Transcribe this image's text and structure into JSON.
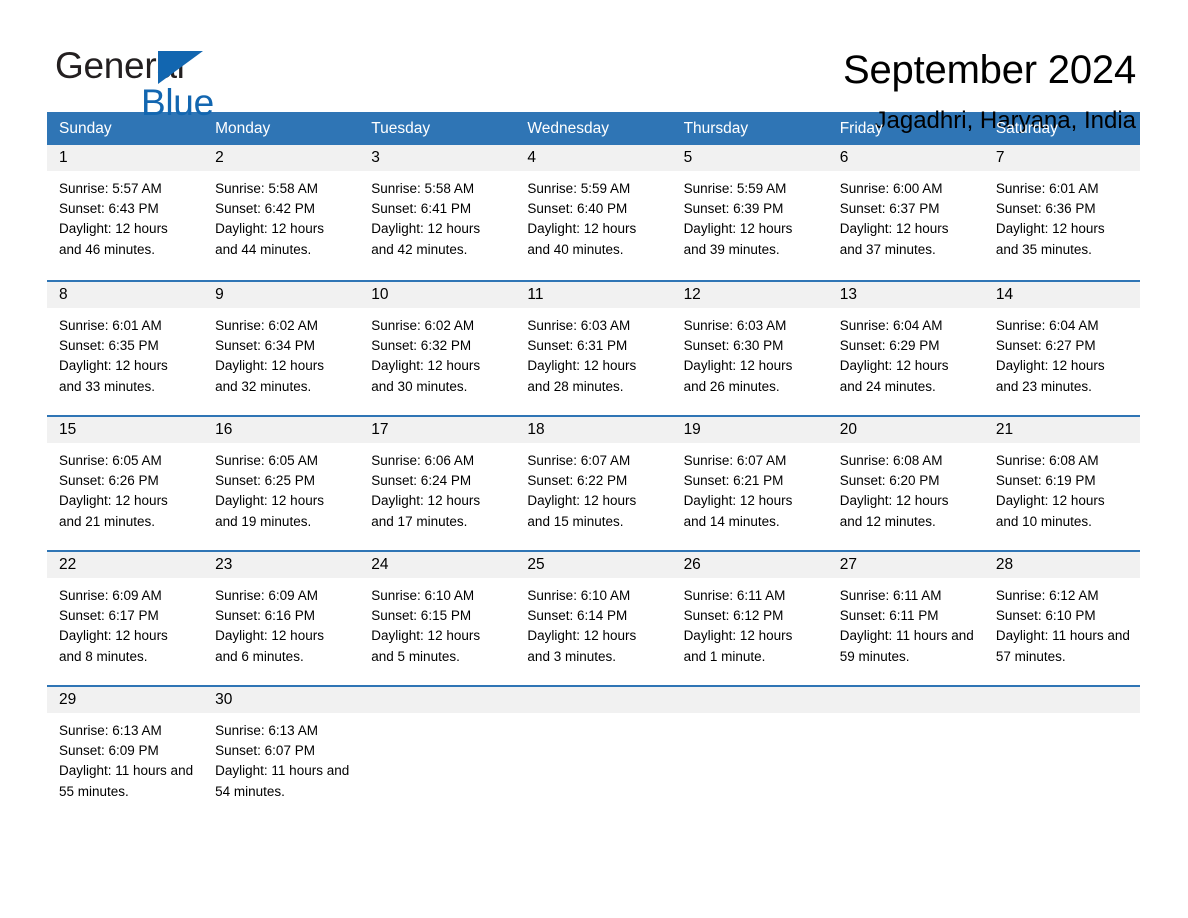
{
  "brand": {
    "name_dark": "General",
    "name_blue": "Blue",
    "accent_color": "#1266b0"
  },
  "header": {
    "month_title": "September 2024",
    "location": "Jagadhri, Haryana, India"
  },
  "theme": {
    "header_blue": "#2f75b5",
    "day_band_gray": "#f1f1f1",
    "text_color": "#000000"
  },
  "calendar": {
    "weekdays": [
      "Sunday",
      "Monday",
      "Tuesday",
      "Wednesday",
      "Thursday",
      "Friday",
      "Saturday"
    ],
    "weeks": [
      [
        {
          "day": "1",
          "sunrise": "Sunrise: 5:57 AM",
          "sunset": "Sunset: 6:43 PM",
          "daylight": "Daylight: 12 hours and 46 minutes."
        },
        {
          "day": "2",
          "sunrise": "Sunrise: 5:58 AM",
          "sunset": "Sunset: 6:42 PM",
          "daylight": "Daylight: 12 hours and 44 minutes."
        },
        {
          "day": "3",
          "sunrise": "Sunrise: 5:58 AM",
          "sunset": "Sunset: 6:41 PM",
          "daylight": "Daylight: 12 hours and 42 minutes."
        },
        {
          "day": "4",
          "sunrise": "Sunrise: 5:59 AM",
          "sunset": "Sunset: 6:40 PM",
          "daylight": "Daylight: 12 hours and 40 minutes."
        },
        {
          "day": "5",
          "sunrise": "Sunrise: 5:59 AM",
          "sunset": "Sunset: 6:39 PM",
          "daylight": "Daylight: 12 hours and 39 minutes."
        },
        {
          "day": "6",
          "sunrise": "Sunrise: 6:00 AM",
          "sunset": "Sunset: 6:37 PM",
          "daylight": "Daylight: 12 hours and 37 minutes."
        },
        {
          "day": "7",
          "sunrise": "Sunrise: 6:01 AM",
          "sunset": "Sunset: 6:36 PM",
          "daylight": "Daylight: 12 hours and 35 minutes."
        }
      ],
      [
        {
          "day": "8",
          "sunrise": "Sunrise: 6:01 AM",
          "sunset": "Sunset: 6:35 PM",
          "daylight": "Daylight: 12 hours and 33 minutes."
        },
        {
          "day": "9",
          "sunrise": "Sunrise: 6:02 AM",
          "sunset": "Sunset: 6:34 PM",
          "daylight": "Daylight: 12 hours and 32 minutes."
        },
        {
          "day": "10",
          "sunrise": "Sunrise: 6:02 AM",
          "sunset": "Sunset: 6:32 PM",
          "daylight": "Daylight: 12 hours and 30 minutes."
        },
        {
          "day": "11",
          "sunrise": "Sunrise: 6:03 AM",
          "sunset": "Sunset: 6:31 PM",
          "daylight": "Daylight: 12 hours and 28 minutes."
        },
        {
          "day": "12",
          "sunrise": "Sunrise: 6:03 AM",
          "sunset": "Sunset: 6:30 PM",
          "daylight": "Daylight: 12 hours and 26 minutes."
        },
        {
          "day": "13",
          "sunrise": "Sunrise: 6:04 AM",
          "sunset": "Sunset: 6:29 PM",
          "daylight": "Daylight: 12 hours and 24 minutes."
        },
        {
          "day": "14",
          "sunrise": "Sunrise: 6:04 AM",
          "sunset": "Sunset: 6:27 PM",
          "daylight": "Daylight: 12 hours and 23 minutes."
        }
      ],
      [
        {
          "day": "15",
          "sunrise": "Sunrise: 6:05 AM",
          "sunset": "Sunset: 6:26 PM",
          "daylight": "Daylight: 12 hours and 21 minutes."
        },
        {
          "day": "16",
          "sunrise": "Sunrise: 6:05 AM",
          "sunset": "Sunset: 6:25 PM",
          "daylight": "Daylight: 12 hours and 19 minutes."
        },
        {
          "day": "17",
          "sunrise": "Sunrise: 6:06 AM",
          "sunset": "Sunset: 6:24 PM",
          "daylight": "Daylight: 12 hours and 17 minutes."
        },
        {
          "day": "18",
          "sunrise": "Sunrise: 6:07 AM",
          "sunset": "Sunset: 6:22 PM",
          "daylight": "Daylight: 12 hours and 15 minutes."
        },
        {
          "day": "19",
          "sunrise": "Sunrise: 6:07 AM",
          "sunset": "Sunset: 6:21 PM",
          "daylight": "Daylight: 12 hours and 14 minutes."
        },
        {
          "day": "20",
          "sunrise": "Sunrise: 6:08 AM",
          "sunset": "Sunset: 6:20 PM",
          "daylight": "Daylight: 12 hours and 12 minutes."
        },
        {
          "day": "21",
          "sunrise": "Sunrise: 6:08 AM",
          "sunset": "Sunset: 6:19 PM",
          "daylight": "Daylight: 12 hours and 10 minutes."
        }
      ],
      [
        {
          "day": "22",
          "sunrise": "Sunrise: 6:09 AM",
          "sunset": "Sunset: 6:17 PM",
          "daylight": "Daylight: 12 hours and 8 minutes."
        },
        {
          "day": "23",
          "sunrise": "Sunrise: 6:09 AM",
          "sunset": "Sunset: 6:16 PM",
          "daylight": "Daylight: 12 hours and 6 minutes."
        },
        {
          "day": "24",
          "sunrise": "Sunrise: 6:10 AM",
          "sunset": "Sunset: 6:15 PM",
          "daylight": "Daylight: 12 hours and 5 minutes."
        },
        {
          "day": "25",
          "sunrise": "Sunrise: 6:10 AM",
          "sunset": "Sunset: 6:14 PM",
          "daylight": "Daylight: 12 hours and 3 minutes."
        },
        {
          "day": "26",
          "sunrise": "Sunrise: 6:11 AM",
          "sunset": "Sunset: 6:12 PM",
          "daylight": "Daylight: 12 hours and 1 minute."
        },
        {
          "day": "27",
          "sunrise": "Sunrise: 6:11 AM",
          "sunset": "Sunset: 6:11 PM",
          "daylight": "Daylight: 11 hours and 59 minutes."
        },
        {
          "day": "28",
          "sunrise": "Sunrise: 6:12 AM",
          "sunset": "Sunset: 6:10 PM",
          "daylight": "Daylight: 11 hours and 57 minutes."
        }
      ],
      [
        {
          "day": "29",
          "sunrise": "Sunrise: 6:13 AM",
          "sunset": "Sunset: 6:09 PM",
          "daylight": "Daylight: 11 hours and 55 minutes."
        },
        {
          "day": "30",
          "sunrise": "Sunrise: 6:13 AM",
          "sunset": "Sunset: 6:07 PM",
          "daylight": "Daylight: 11 hours and 54 minutes."
        },
        {
          "day": "",
          "sunrise": "",
          "sunset": "",
          "daylight": ""
        },
        {
          "day": "",
          "sunrise": "",
          "sunset": "",
          "daylight": ""
        },
        {
          "day": "",
          "sunrise": "",
          "sunset": "",
          "daylight": ""
        },
        {
          "day": "",
          "sunrise": "",
          "sunset": "",
          "daylight": ""
        },
        {
          "day": "",
          "sunrise": "",
          "sunset": "",
          "daylight": ""
        }
      ]
    ]
  }
}
